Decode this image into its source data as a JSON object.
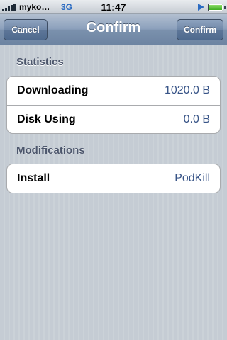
{
  "status_bar": {
    "carrier": "myko…",
    "network": "3G",
    "time": "11:47",
    "accent_color": "#2b6bc2"
  },
  "nav": {
    "title": "Confirm",
    "left_button": "Cancel",
    "right_button": "Confirm"
  },
  "sections": [
    {
      "header": "Statistics",
      "rows": [
        {
          "label": "Downloading",
          "value": "1020.0 B"
        },
        {
          "label": "Disk Using",
          "value": "0.0 B"
        }
      ]
    },
    {
      "header": "Modifications",
      "rows": [
        {
          "label": "Install",
          "value": "PodKill"
        }
      ]
    }
  ]
}
